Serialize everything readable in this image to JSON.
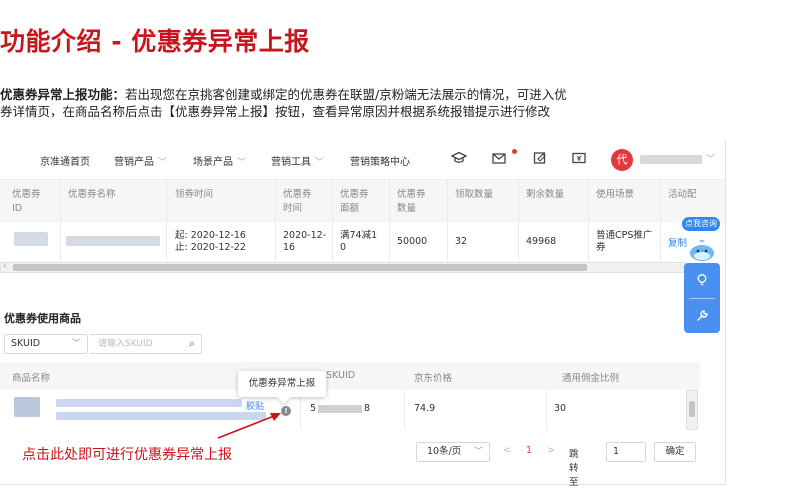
{
  "slide": {
    "title": "功能介绍 - 优惠券异常上报",
    "intro_bold": "优惠券异常上报功能：",
    "intro_line1": "若出现您在京挑客创建或绑定的优惠券在联盟/京粉端无法展示的情况，可进入优",
    "intro_line2": "券详情页，在商品名称后点击【优惠券异常上报】按钮，查看异常原因并根据系统报错提示进行修改"
  },
  "nav": {
    "items": [
      {
        "label": "京准通首页",
        "has_chevron": false
      },
      {
        "label": "营销产品",
        "has_chevron": true
      },
      {
        "label": "场景产品",
        "has_chevron": true
      },
      {
        "label": "营销工具",
        "has_chevron": true
      },
      {
        "label": "营销策略中心",
        "has_chevron": false
      }
    ],
    "icons": [
      "graduation-cap-icon",
      "mail-icon",
      "edit-icon",
      "currency-icon"
    ],
    "avatar_text": "代"
  },
  "coupon_table": {
    "columns": [
      "优惠券ID",
      "优惠券名称",
      "领券时间",
      "优惠券时间",
      "优惠券面额",
      "优惠券数量",
      "领取数量",
      "剩余数量",
      "使用场景",
      "活动配"
    ],
    "row": {
      "claim_start": "起: 2020-12-16",
      "claim_end": "止: 2020-12-22",
      "coupon_time": "2020-12-16",
      "face_value": "满74减10",
      "quantity": "50000",
      "claimed": "32",
      "remaining": "49968",
      "scene": "普通CPS推广券",
      "action": "复制"
    }
  },
  "float_tools": {
    "consult_label": "点我咨询"
  },
  "products": {
    "section_title": "优惠券使用商品",
    "filter_select": "SKUID",
    "search_placeholder": "请输入SKUID",
    "columns": [
      "商品名称",
      "SKUID",
      "京东价格",
      "通用佣金比例"
    ],
    "row": {
      "name_fragment": "胶贴",
      "skuid_start": "5",
      "skuid_end": "8",
      "price": "74.9",
      "commission": "30"
    },
    "tooltip": "优惠券异常上报",
    "warn_symbol": "!"
  },
  "callout": "点击此处即可进行优惠券异常上报",
  "pager": {
    "page_size": "10条/页",
    "prev": "<",
    "current": "1",
    "next": ">",
    "jump_label": "跳转至",
    "jump_value": "1",
    "ok": "确定"
  }
}
